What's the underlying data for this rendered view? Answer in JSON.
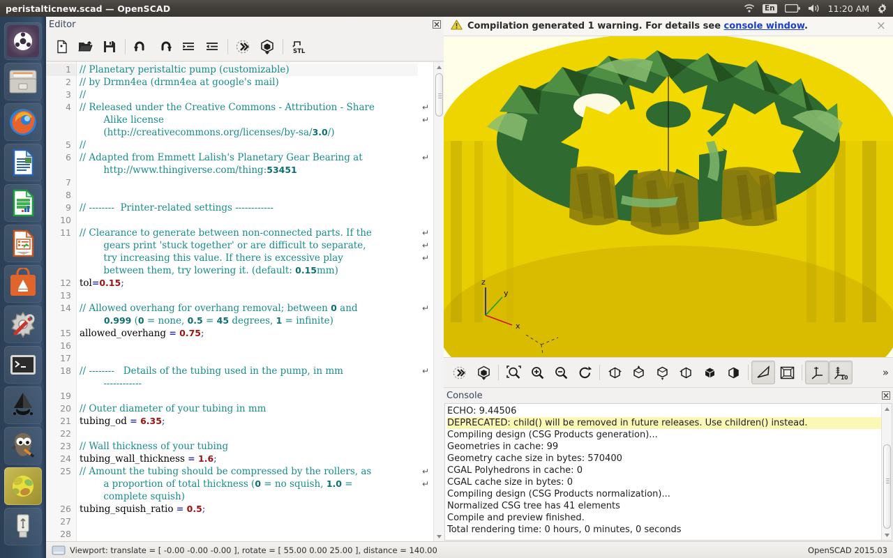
{
  "window": {
    "title": "peristalticnew.scad — OpenSCAD"
  },
  "tray": {
    "wifi_icon": "wifi-icon",
    "keyboard_layout": "En",
    "battery_icon": "battery-icon",
    "volume_icon": "volume-icon",
    "clock": "11:20 AM",
    "gear_icon": "gear-icon"
  },
  "launcher": {
    "items": [
      {
        "name": "ubuntu-dash",
        "label": "Dash home"
      },
      {
        "name": "files",
        "label": "Files"
      },
      {
        "name": "firefox",
        "label": "Firefox Web Browser"
      },
      {
        "name": "libreoffice-writer",
        "label": "LibreOffice Writer"
      },
      {
        "name": "libreoffice-calc",
        "label": "LibreOffice Calc"
      },
      {
        "name": "libreoffice-impress",
        "label": "LibreOffice Impress"
      },
      {
        "name": "software-center",
        "label": "Ubuntu Software Center"
      },
      {
        "name": "system-settings",
        "label": "System Settings"
      },
      {
        "name": "terminal",
        "label": "Terminal"
      },
      {
        "name": "inkscape",
        "label": "Inkscape"
      },
      {
        "name": "gimp",
        "label": "GIMP"
      },
      {
        "name": "openscad",
        "label": "OpenSCAD",
        "active": true
      },
      {
        "name": "usb-drive",
        "label": "USB Drive"
      }
    ]
  },
  "editor": {
    "dock_title": "Editor",
    "close_label": "×",
    "toolbar": [
      {
        "name": "new-file-button",
        "label": "New"
      },
      {
        "name": "open-file-button",
        "label": "Open"
      },
      {
        "name": "save-file-button",
        "label": "Save"
      },
      {
        "name": "undo-button",
        "label": "Undo"
      },
      {
        "name": "redo-button",
        "label": "Redo"
      },
      {
        "name": "unindent-button",
        "label": "Unindent"
      },
      {
        "name": "indent-button",
        "label": "Indent"
      },
      {
        "name": "preview-button",
        "label": "Preview"
      },
      {
        "name": "render-button",
        "label": "Render"
      },
      {
        "name": "export-stl-button",
        "label": "Export as STL"
      }
    ],
    "lines": [
      {
        "n": "1",
        "cur": true,
        "parts": [
          {
            "t": "cmt",
            "v": "// Planetary peristaltic pump (customizable)"
          }
        ]
      },
      {
        "n": "2",
        "parts": [
          {
            "t": "cmt",
            "v": "// by Drmn4ea (drmn4ea at google's mail)"
          }
        ]
      },
      {
        "n": "3",
        "parts": [
          {
            "t": "cmt",
            "v": "//"
          }
        ]
      },
      {
        "n": "4",
        "parts": [
          {
            "t": "cmt",
            "v": "// Released under the Creative Commons - Attribution - Share"
          }
        ],
        "wrap": true
      },
      {
        "n": "",
        "parts": [
          {
            "t": "cmt",
            "v": "        Alike license"
          }
        ],
        "wrap": true
      },
      {
        "n": "",
        "parts": [
          {
            "t": "cmt",
            "v": "        (http://creativecommons.org/licenses/by-sa/"
          },
          {
            "t": "cmtb",
            "v": "3.0"
          },
          {
            "t": "cmt",
            "v": "/)"
          }
        ]
      },
      {
        "n": "5",
        "parts": [
          {
            "t": "cmt",
            "v": "//"
          }
        ]
      },
      {
        "n": "6",
        "parts": [
          {
            "t": "cmt",
            "v": "// Adapted from Emmett Lalish's Planetary Gear Bearing at"
          }
        ],
        "wrap": true
      },
      {
        "n": "",
        "parts": [
          {
            "t": "cmt",
            "v": "        http://www.thingiverse.com/thing:"
          },
          {
            "t": "cmtb",
            "v": "53451"
          }
        ]
      },
      {
        "n": "7",
        "parts": []
      },
      {
        "n": "8",
        "parts": []
      },
      {
        "n": "9",
        "parts": [
          {
            "t": "cmt",
            "v": "// --------  Printer-related settings ------------"
          }
        ]
      },
      {
        "n": "10",
        "parts": []
      },
      {
        "n": "11",
        "parts": [
          {
            "t": "cmt",
            "v": "// Clearance to generate between non-connected parts. If the"
          }
        ],
        "wrap": true
      },
      {
        "n": "",
        "parts": [
          {
            "t": "cmt",
            "v": "        gears print 'stuck together' or are difficult to separate,"
          }
        ],
        "wrap": true
      },
      {
        "n": "",
        "parts": [
          {
            "t": "cmt",
            "v": "        try increasing this value. If there is excessive play"
          }
        ],
        "wrap": true
      },
      {
        "n": "",
        "parts": [
          {
            "t": "cmt",
            "v": "        between them, try lowering it. (default: "
          },
          {
            "t": "cmtb",
            "v": "0.15"
          },
          {
            "t": "cmt",
            "v": "mm)"
          }
        ]
      },
      {
        "n": "12",
        "parts": [
          {
            "t": "idn",
            "v": "tol"
          },
          {
            "t": "op",
            "v": "="
          },
          {
            "t": "num",
            "v": "0.15"
          },
          {
            "t": "smc",
            "v": ";"
          }
        ]
      },
      {
        "n": "13",
        "parts": []
      },
      {
        "n": "14",
        "parts": [
          {
            "t": "cmt",
            "v": "// Allowed overhang for overhang removal; between "
          },
          {
            "t": "cmtb",
            "v": "0"
          },
          {
            "t": "cmt",
            "v": " and"
          }
        ],
        "wrap": true
      },
      {
        "n": "",
        "parts": [
          {
            "t": "cmtb",
            "v": "        0.999"
          },
          {
            "t": "cmt",
            "v": " ("
          },
          {
            "t": "cmtb",
            "v": "0"
          },
          {
            "t": "cmt",
            "v": " = none, "
          },
          {
            "t": "cmtb",
            "v": "0.5"
          },
          {
            "t": "cmt",
            "v": " = "
          },
          {
            "t": "cmtb",
            "v": "45"
          },
          {
            "t": "cmt",
            "v": " degrees, "
          },
          {
            "t": "cmtb",
            "v": "1"
          },
          {
            "t": "cmt",
            "v": " = infinite)"
          }
        ]
      },
      {
        "n": "15",
        "parts": [
          {
            "t": "idn",
            "v": "allowed_overhang "
          },
          {
            "t": "op",
            "v": "="
          },
          {
            "t": "num",
            "v": " 0.75"
          },
          {
            "t": "smc",
            "v": ";"
          }
        ]
      },
      {
        "n": "16",
        "parts": []
      },
      {
        "n": "17",
        "parts": []
      },
      {
        "n": "18",
        "parts": [
          {
            "t": "cmt",
            "v": "// --------   Details of the tubing used in the pump, in mm"
          }
        ],
        "wrap": true
      },
      {
        "n": "",
        "parts": [
          {
            "t": "cmt",
            "v": "        ------------"
          }
        ]
      },
      {
        "n": "19",
        "parts": []
      },
      {
        "n": "20",
        "parts": [
          {
            "t": "cmt",
            "v": "// Outer diameter of your tubing in mm"
          }
        ]
      },
      {
        "n": "21",
        "parts": [
          {
            "t": "idn",
            "v": "tubing_od "
          },
          {
            "t": "op",
            "v": "="
          },
          {
            "t": "num",
            "v": " 6.35"
          },
          {
            "t": "smc",
            "v": ";"
          }
        ]
      },
      {
        "n": "22",
        "parts": []
      },
      {
        "n": "23",
        "parts": [
          {
            "t": "cmt",
            "v": "// Wall thickness of your tubing"
          }
        ]
      },
      {
        "n": "24",
        "parts": [
          {
            "t": "idn",
            "v": "tubing_wall_thickness "
          },
          {
            "t": "op",
            "v": "="
          },
          {
            "t": "num",
            "v": " 1.6"
          },
          {
            "t": "smc",
            "v": ";"
          }
        ]
      },
      {
        "n": "25",
        "parts": [
          {
            "t": "cmt",
            "v": "// Amount the tubing should be compressed by the rollers, as"
          }
        ],
        "wrap": true
      },
      {
        "n": "",
        "parts": [
          {
            "t": "cmt",
            "v": "        a proportion of total thickness ("
          },
          {
            "t": "cmtb",
            "v": "0"
          },
          {
            "t": "cmt",
            "v": " = no squish, "
          },
          {
            "t": "cmtb",
            "v": "1.0"
          },
          {
            "t": "cmt",
            "v": " ="
          }
        ],
        "wrap": true
      },
      {
        "n": "",
        "parts": [
          {
            "t": "cmt",
            "v": "        complete squish)"
          }
        ]
      },
      {
        "n": "26",
        "parts": [
          {
            "t": "idn",
            "v": "tubing_squish_ratio "
          },
          {
            "t": "op",
            "v": "="
          },
          {
            "t": "num",
            "v": " 0.5"
          },
          {
            "t": "smc",
            "v": ";"
          }
        ]
      },
      {
        "n": "27",
        "parts": []
      },
      {
        "n": "28",
        "parts": []
      }
    ]
  },
  "warning": {
    "icon": "warning-triangle-icon",
    "text_before": "Compilation generated 1 warning. For details see ",
    "link": "console window",
    "text_after": ".",
    "close_label": "×"
  },
  "viewport": {
    "axis_labels": {
      "x": "x",
      "y": "y",
      "z": "z"
    },
    "axis_colors": {
      "x": "#d01010",
      "y": "#10a010",
      "z": "#1010c0"
    },
    "background": "#fffee8",
    "model_colors": {
      "outside": "#f0d800",
      "inside": "#40a040",
      "shadow": "#8a7a10"
    }
  },
  "view_toolbar": [
    {
      "name": "preview-button",
      "label": "Preview",
      "pressed": false
    },
    {
      "name": "render-button",
      "label": "Render",
      "pressed": false
    },
    {
      "name": "zoom-all-button",
      "label": "View All",
      "pressed": false
    },
    {
      "name": "zoom-in-button",
      "label": "Zoom In",
      "pressed": false
    },
    {
      "name": "zoom-out-button",
      "label": "Zoom Out",
      "pressed": false
    },
    {
      "name": "reset-view-button",
      "label": "Reset View",
      "pressed": false
    },
    {
      "name": "right-view-button",
      "label": "Right View",
      "pressed": false
    },
    {
      "name": "top-view-button",
      "label": "Top View",
      "pressed": false
    },
    {
      "name": "bottom-view-button",
      "label": "Bottom View",
      "pressed": false
    },
    {
      "name": "left-view-button",
      "label": "Left View",
      "pressed": false
    },
    {
      "name": "front-view-button",
      "label": "Front View",
      "pressed": false
    },
    {
      "name": "back-view-button",
      "label": "Back View",
      "pressed": false
    },
    {
      "name": "perspective-view-button",
      "label": "Perspective",
      "pressed": true
    },
    {
      "name": "orthogonal-view-button",
      "label": "Orthogonal",
      "pressed": false
    },
    {
      "name": "show-axes-button",
      "label": "Show Axes",
      "pressed": true
    },
    {
      "name": "show-scale-markers-button",
      "label": "Show Scale Markers",
      "pressed": true
    }
  ],
  "view_toolbar_more": "»",
  "console": {
    "dock_title": "Console",
    "close_label": "×",
    "lines": [
      {
        "text": "ECHO: 9.44506",
        "warn": false
      },
      {
        "text": "DEPRECATED: child() will be removed in future releases. Use children() instead.",
        "warn": true
      },
      {
        "text": "Compiling design (CSG Products generation)...",
        "warn": false
      },
      {
        "text": "Geometries in cache: 99",
        "warn": false
      },
      {
        "text": "Geometry cache size in bytes: 570400",
        "warn": false
      },
      {
        "text": "CGAL Polyhedrons in cache: 0",
        "warn": false
      },
      {
        "text": "CGAL cache size in bytes: 0",
        "warn": false
      },
      {
        "text": "Compiling design (CSG Products normalization)...",
        "warn": false
      },
      {
        "text": "Normalized CSG tree has 41 elements",
        "warn": false
      },
      {
        "text": "Compile and preview finished.",
        "warn": false
      },
      {
        "text": "Total rendering time: 0 hours, 0 minutes, 0 seconds",
        "warn": false
      }
    ]
  },
  "statusbar": {
    "viewport_info": "Viewport: translate = [ -0.00 -0.00 -0.00 ], rotate = [ 55.00 0.00 25.00 ], distance = 140.00",
    "version": "OpenSCAD 2015.03"
  }
}
